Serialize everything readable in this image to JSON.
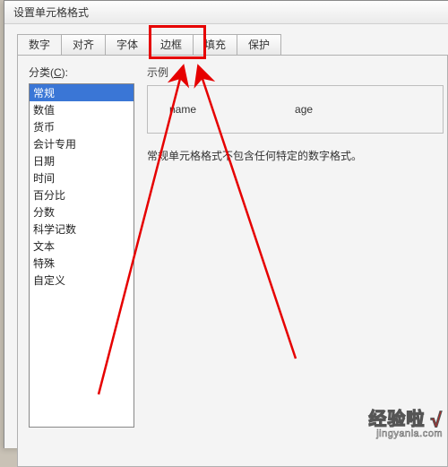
{
  "dialog": {
    "title": "设置单元格格式"
  },
  "tabs": {
    "items": [
      {
        "label": "数字"
      },
      {
        "label": "对齐"
      },
      {
        "label": "字体"
      },
      {
        "label": "边框"
      },
      {
        "label": "填充"
      },
      {
        "label": "保护"
      }
    ],
    "activeIndex": 0,
    "highlightIndex": 3
  },
  "category": {
    "label_pre": "分类(",
    "label_key": "C",
    "label_post": "):",
    "items": [
      "常规",
      "数值",
      "货币",
      "会计专用",
      "日期",
      "时间",
      "百分比",
      "分数",
      "科学记数",
      "文本",
      "特殊",
      "自定义"
    ],
    "selectedIndex": 0
  },
  "preview": {
    "label": "示例",
    "col1": "name",
    "col2": "age"
  },
  "description": "常规单元格格式不包含任何特定的数字格式。",
  "watermark": {
    "brand": "经验啦",
    "domain": "jingyanla.com"
  },
  "annotation": {
    "color": "#e60000"
  }
}
